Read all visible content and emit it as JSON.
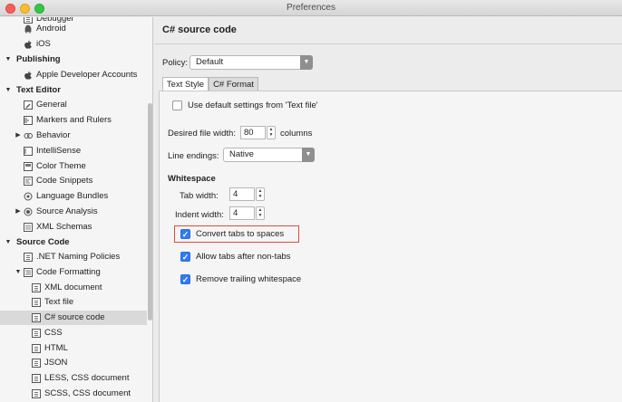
{
  "window": {
    "title": "Preferences"
  },
  "sidebar": {
    "items": [
      {
        "label": "Debugger",
        "level": 2,
        "icon": "debugger-icon"
      },
      {
        "label": "Android",
        "level": 2,
        "icon": "android-icon"
      },
      {
        "label": "iOS",
        "level": 2,
        "icon": "apple-icon"
      },
      {
        "label": "Publishing",
        "level": 0,
        "expanded": true
      },
      {
        "label": "Apple Developer Accounts",
        "level": 2,
        "icon": "apple-icon"
      },
      {
        "label": "Text Editor",
        "level": 0,
        "expanded": true
      },
      {
        "label": "General",
        "level": 2,
        "icon": "pencil-icon"
      },
      {
        "label": "Markers and Rulers",
        "level": 2,
        "icon": "ruler-icon"
      },
      {
        "label": "Behavior",
        "level": 1,
        "expanded": false,
        "icon": "behavior-icon"
      },
      {
        "label": "IntelliSense",
        "level": 2,
        "icon": "intellisense-icon"
      },
      {
        "label": "Color Theme",
        "level": 2,
        "icon": "color-theme-icon"
      },
      {
        "label": "Code Snippets",
        "level": 2,
        "icon": "snippet-icon"
      },
      {
        "label": "Language Bundles",
        "level": 2,
        "icon": "bundle-icon"
      },
      {
        "label": "Source Analysis",
        "level": 1,
        "expanded": false,
        "icon": "source-analysis-icon"
      },
      {
        "label": "XML Schemas",
        "level": 2,
        "icon": "schema-icon"
      },
      {
        "label": "Source Code",
        "level": 0,
        "expanded": true
      },
      {
        "label": ".NET Naming Policies",
        "level": 2,
        "icon": "document-icon"
      },
      {
        "label": "Code Formatting",
        "level": 1,
        "expanded": true,
        "icon": "formatting-icon"
      },
      {
        "label": "XML document",
        "level": 3,
        "icon": "document-icon"
      },
      {
        "label": "Text file",
        "level": 3,
        "icon": "document-icon"
      },
      {
        "label": "C# source code",
        "level": 3,
        "icon": "document-icon",
        "selected": true
      },
      {
        "label": "CSS",
        "level": 3,
        "icon": "document-icon"
      },
      {
        "label": "HTML",
        "level": 3,
        "icon": "document-icon"
      },
      {
        "label": "JSON",
        "level": 3,
        "icon": "document-icon"
      },
      {
        "label": "LESS, CSS document",
        "level": 3,
        "icon": "document-icon"
      },
      {
        "label": "SCSS, CSS document",
        "level": 3,
        "icon": "document-icon"
      }
    ]
  },
  "main": {
    "title": "C# source code",
    "policy": {
      "label": "Policy:",
      "value": "Default"
    },
    "tabs": [
      {
        "label": "Text Style",
        "active": true
      },
      {
        "label": "C# Format",
        "active": false
      }
    ],
    "use_default": {
      "label": "Use default settings from 'Text file'",
      "checked": false
    },
    "desired_width": {
      "label": "Desired file width:",
      "value": "80",
      "suffix": "columns"
    },
    "line_endings": {
      "label": "Line endings:",
      "value": "Native"
    },
    "whitespace": {
      "heading": "Whitespace",
      "tab_width": {
        "label": "Tab width:",
        "value": "4"
      },
      "indent_width": {
        "label": "Indent width:",
        "value": "4"
      },
      "convert_tabs": {
        "label": "Convert tabs to spaces",
        "checked": true
      },
      "allow_tabs": {
        "label": "Allow tabs after non-tabs",
        "checked": true
      },
      "remove_trailing": {
        "label": "Remove trailing whitespace",
        "checked": true
      }
    }
  },
  "colors": {
    "accent": "#2f7bf5",
    "highlight_box": "#e6493a",
    "selected_row": "#d9d9d9"
  }
}
